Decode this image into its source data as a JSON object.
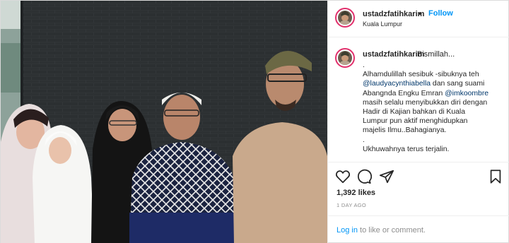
{
  "post": {
    "username": "ustadzfatihkarim",
    "separator": "•",
    "follow_label": "Follow",
    "location": "Kuala Lumpur"
  },
  "caption": {
    "username": "ustadzfatihkarim",
    "first_line": "Bismillah...",
    "lines": [
      ".",
      "Alhamdulillah sesibuk -sibuknya teh",
      "",
      "Abangnda Engku Emran",
      "masih selalu menyibukkan diri dengan",
      "Hadir di Kajian bahkan di Kuala",
      "Lumpur pun aktif menghidupkan",
      "majelis Ilmu..Bahagianya.",
      ".",
      "Ukhuwahnya terus terjalin."
    ],
    "mention_1": "@laudyacynthiabella",
    "after_mention_1": " dan sang suami",
    "mention_2": "@imkoombre"
  },
  "actions": {
    "like_icon": "heart-icon",
    "comment_icon": "comment-icon",
    "share_icon": "paper-plane-icon",
    "save_icon": "bookmark-icon"
  },
  "likes_text": "1,392 likes",
  "timestamp": "1 DAY AGO",
  "footer": {
    "login_label": "Log in",
    "login_rest": " to like or comment."
  },
  "colors": {
    "link_blue": "#0095f6",
    "mention_blue": "#00376b",
    "muted_gray": "#8e8e8e",
    "story_ring": "#e1306c"
  }
}
